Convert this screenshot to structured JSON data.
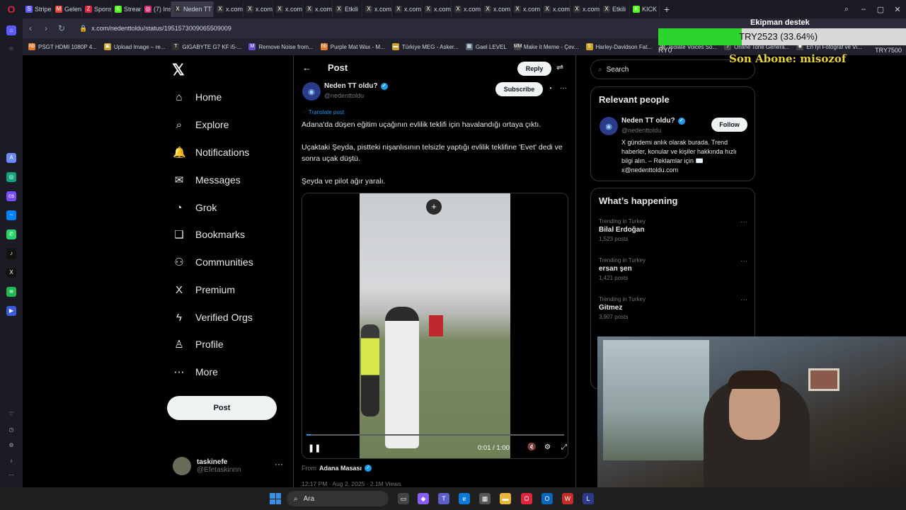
{
  "browser": {
    "tabs": [
      {
        "label": "Stripe",
        "icon": "S",
        "color": "#635bff"
      },
      {
        "label": "Gelen",
        "icon": "M",
        "color": "#ea4335"
      },
      {
        "label": "Spons",
        "icon": "Z",
        "color": "#e0243c"
      },
      {
        "label": "Stream",
        "icon": "K",
        "color": "#53fc18"
      },
      {
        "label": "(7) Ins",
        "icon": "◎",
        "color": "#d62976"
      },
      {
        "label": "Neden TT c",
        "icon": "X",
        "color": "#333333"
      },
      {
        "label": "x.com",
        "icon": "X",
        "color": "#333333"
      },
      {
        "label": "x.com",
        "icon": "X",
        "color": "#333333"
      },
      {
        "label": "x.com",
        "icon": "X",
        "color": "#333333"
      },
      {
        "label": "x.com",
        "icon": "X",
        "color": "#333333"
      },
      {
        "label": "Etkili",
        "icon": "X",
        "color": "#333333"
      },
      {
        "label": "x.com",
        "icon": "X",
        "color": "#333333"
      },
      {
        "label": "x.com",
        "icon": "X",
        "color": "#333333"
      },
      {
        "label": "x.com",
        "icon": "X",
        "color": "#333333"
      },
      {
        "label": "x.com",
        "icon": "X",
        "color": "#333333"
      },
      {
        "label": "x.com",
        "icon": "X",
        "color": "#333333"
      },
      {
        "label": "x.com",
        "icon": "X",
        "color": "#333333"
      },
      {
        "label": "x.com",
        "icon": "X",
        "color": "#333333"
      },
      {
        "label": "x.com",
        "icon": "X",
        "color": "#333333"
      },
      {
        "label": "Etkili",
        "icon": "X",
        "color": "#333333"
      },
      {
        "label": "KICK S",
        "icon": "K",
        "color": "#53fc18"
      }
    ],
    "active_tab": 5,
    "url": "x.com/nedenttoldu/status/1951573009065509009",
    "bookmarks": [
      {
        "label": "PSGT HDMI 1080P 4...",
        "icon": "hb",
        "color": "#e07a2a"
      },
      {
        "label": "Upload Image – re...",
        "icon": "▣",
        "color": "#c9a227"
      },
      {
        "label": "GIGABYTE G7 KF i5-...",
        "icon": "T",
        "color": "#333333"
      },
      {
        "label": "Remove Noise from...",
        "icon": "M",
        "color": "#6a4bd6"
      },
      {
        "label": "Purple Mat Wax - M...",
        "icon": "hb",
        "color": "#e07a2a"
      },
      {
        "label": "Türkiye MEG - Asker...",
        "icon": "▬",
        "color": "#c9a227"
      },
      {
        "label": "Gael LEVEL",
        "icon": "▦",
        "color": "#556677"
      },
      {
        "label": "Make it Meme - Çev...",
        "icon": "MM",
        "color": "#444444"
      },
      {
        "label": "Harley-Davidson Fat...",
        "icon": "S",
        "color": "#c9a227"
      },
      {
        "label": "Isolate Voices So...",
        "icon": "◎",
        "color": "#444444"
      },
      {
        "label": "Online Tone Genera...",
        "icon": "♪",
        "color": "#444444"
      },
      {
        "label": "En İyi Fotoğraf ve Vi...",
        "icon": "◉",
        "color": "#444444"
      }
    ]
  },
  "nav": {
    "items": [
      {
        "label": "Home",
        "icon": "⌂"
      },
      {
        "label": "Explore",
        "icon": "⌕"
      },
      {
        "label": "Notifications",
        "icon": "🔔"
      },
      {
        "label": "Messages",
        "icon": "✉"
      },
      {
        "label": "Grok",
        "icon": "◔"
      },
      {
        "label": "Bookmarks",
        "icon": "❑"
      },
      {
        "label": "Communities",
        "icon": "⚇"
      },
      {
        "label": "Premium",
        "icon": "X"
      },
      {
        "label": "Verified Orgs",
        "icon": "ϟ"
      },
      {
        "label": "Profile",
        "icon": "♙"
      },
      {
        "label": "More",
        "icon": "⋯"
      }
    ],
    "post_label": "Post",
    "account": {
      "name": "taskinefe",
      "handle": "@Efetaskinnn"
    }
  },
  "post": {
    "header_title": "Post",
    "reply_label": "Reply",
    "author_name": "Neden TT oldu?",
    "author_handle": "@nedenttoldu",
    "subscribe_label": "Subscribe",
    "translate_label": "Translate post",
    "paragraphs": [
      "Adana'da düşen eğitim uçağının evlilik teklifi için havalandığı ortaya çıktı.",
      "Uçaktaki Şeyda, pistteki nişanlısının telsizle yaptığı evlilik teklifine 'Evet' dedi ve sonra uçak düştü.",
      "Şeyda ve pilot ağır yaralı."
    ],
    "video": {
      "time": "0:01 / 1:00",
      "progress": 0.017
    },
    "from_label": "From",
    "from_name": "Adana Masası",
    "meta": "12:17 PM · Aug 2, 2025 · 2.1M Views"
  },
  "sidebar": {
    "search_placeholder": "Search",
    "relevant_title": "Relevant people",
    "person": {
      "name": "Neden TT oldu?",
      "handle": "@nedenttoldu",
      "follow_label": "Follow",
      "bio": "X gündemi anlık olarak burada. Trend haberler, konular ve kişiler hakkında hızlı bilgi alın. – Reklamlar için ✉️ x@nedenttoldu.com"
    },
    "happening_title": "What’s happening",
    "trends": [
      {
        "category": "Trending in Turkey",
        "name": "Bilal Erdoğan",
        "count": "1,523 posts"
      },
      {
        "category": "Trending in Turkey",
        "name": "ersan şen",
        "count": "1,421 posts"
      },
      {
        "category": "Trending in Turkey",
        "name": "Gitmez",
        "count": "3,907 posts"
      }
    ]
  },
  "overlay": {
    "donation_title": "Ekipman destek",
    "donation_text": "TRY2523 (33.64%)",
    "donation_progress": 0.3364,
    "donation_left": "RY0",
    "donation_right": "TRY7500",
    "last_sub": "Son Abone: misozof"
  },
  "taskbar": {
    "search_placeholder": "Ara"
  }
}
